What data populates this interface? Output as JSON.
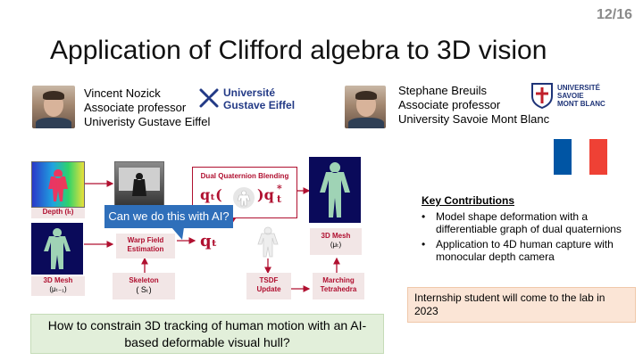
{
  "slide": {
    "page_number": "12/16",
    "title": "Application of Clifford algebra to 3D vision"
  },
  "people": [
    {
      "name": "Vincent Nozick",
      "role": "Associate professor",
      "affiliation": "Univeristy Gustave Eiffel"
    },
    {
      "name": "Stephane Breuils",
      "role": "Associate professor",
      "affiliation": "University Savoie Mont Blanc"
    }
  ],
  "logos": {
    "ugf": {
      "line1": "Université",
      "line2": "Gustave Eiffel",
      "color": "#233a86"
    },
    "usmb": {
      "line1": "UNIVERSITÉ",
      "line2": "SAVOIE",
      "line3": "MONT BLANC",
      "color": "#1f3478"
    }
  },
  "flag_colors": [
    "#0055A4",
    "#FFFFFF",
    "#EF4135"
  ],
  "diagram": {
    "depth_label": "Depth (Iₜ)",
    "mesh_prev_label": "3D Mesh",
    "mesh_prev_sub": "(μₜ₋₁)",
    "warp_label_1": "Warp Field",
    "warp_label_2": "Estimation",
    "skeleton_label": "Skeleton",
    "skeleton_sub": "( Sₜ)",
    "dq_label": "Dual Quaternion Blending",
    "dq_formula_left": "qₜ(",
    "dq_formula_right": ")q",
    "qt_label": "qₜ",
    "mesh_out_label": "3D Mesh",
    "mesh_out_sub": "(μₜ)",
    "tsdf_label_1": "TSDF",
    "tsdf_label_2": "Update",
    "marching_label_1": "Marching",
    "marching_label_2": "Tetrahedra",
    "callout": "Can we do this with AI?"
  },
  "key_contributions": {
    "title": "Key Contributions",
    "items": [
      "Model shape deformation with a differentiable graph of dual quaternions",
      "Application to 4D human capture with monocular depth camera"
    ]
  },
  "internship_note": "Internship student will come to the lab in 2023",
  "question": "How to constrain 3D tracking of human motion with an AI-based deformable visual hull?"
}
